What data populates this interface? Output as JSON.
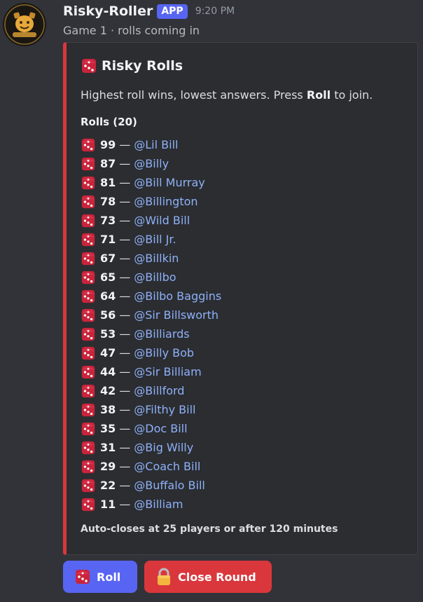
{
  "message": {
    "username": "Risky-Roller",
    "badge": "APP",
    "timestamp": "9:20 PM",
    "subtitle": "Game 1 · rolls coming in"
  },
  "embed": {
    "accent_color": "#da373c",
    "title_icon": "dice-icon",
    "title": "Risky Rolls",
    "description_pre": "Highest roll wins, lowest answers. Press ",
    "description_bold": "Roll",
    "description_post": " to join.",
    "field_name": "Rolls (20)",
    "rolls": [
      {
        "value": "99",
        "user": "@Lil Bill"
      },
      {
        "value": "87",
        "user": "@Billy"
      },
      {
        "value": "81",
        "user": "@Bill Murray"
      },
      {
        "value": "78",
        "user": "@Billington"
      },
      {
        "value": "73",
        "user": "@Wild Bill"
      },
      {
        "value": "71",
        "user": "@Bill Jr."
      },
      {
        "value": "67",
        "user": "@Billkin"
      },
      {
        "value": "65",
        "user": "@Billbo"
      },
      {
        "value": "64",
        "user": "@Bilbo Baggins"
      },
      {
        "value": "56",
        "user": "@Sir Billsworth"
      },
      {
        "value": "53",
        "user": "@Billiards"
      },
      {
        "value": "47",
        "user": "@Billy Bob"
      },
      {
        "value": "44",
        "user": "@Sir Billiam"
      },
      {
        "value": "42",
        "user": "@Billford"
      },
      {
        "value": "38",
        "user": "@Filthy Bill"
      },
      {
        "value": "35",
        "user": "@Doc Bill"
      },
      {
        "value": "31",
        "user": "@Big Willy"
      },
      {
        "value": "29",
        "user": "@Coach Bill"
      },
      {
        "value": "22",
        "user": "@Buffalo Bill"
      },
      {
        "value": "11",
        "user": "@Billiam"
      }
    ],
    "separator": "—",
    "footer": "Auto-closes at 25 players or after 120 minutes"
  },
  "buttons": {
    "roll": {
      "label": "Roll",
      "icon": "dice-icon",
      "color": "#5865f2"
    },
    "close": {
      "label": "Close Round",
      "icon": "lock-icon",
      "color": "#da373c"
    }
  }
}
